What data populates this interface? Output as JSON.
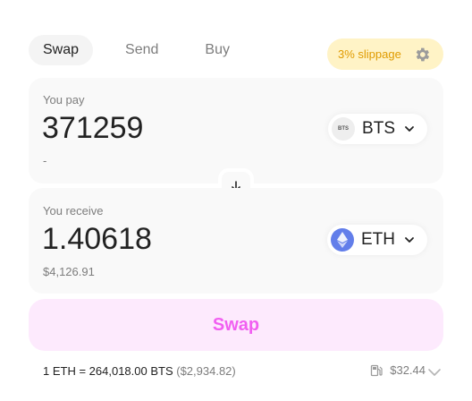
{
  "tabs": [
    {
      "label": "Swap",
      "active": true
    },
    {
      "label": "Send",
      "active": false
    },
    {
      "label": "Buy",
      "active": false
    }
  ],
  "slippage": {
    "label": "3% slippage",
    "icon": "gear-icon"
  },
  "pay": {
    "label": "You pay",
    "amount": "371259",
    "fiat": "-",
    "token": {
      "symbol": "BTS",
      "logo_text": "BTS"
    }
  },
  "receive": {
    "label": "You receive",
    "amount": "1.40618",
    "fiat": "$4,126.91",
    "token": {
      "symbol": "ETH",
      "logo": "ethereum-logo"
    }
  },
  "switch": {
    "icon": "arrow-down-icon"
  },
  "swap_button": {
    "label": "Swap"
  },
  "rate": {
    "text": "1 ETH = 264,018.00 BTS",
    "fiat": "($2,934.82)"
  },
  "gas": {
    "icon": "gas-pump-icon",
    "value": "$32.44"
  },
  "colors": {
    "accent": "#f15ff1",
    "swap_bg": "#fdeafd",
    "slippage_bg": "#fff3c6",
    "slippage_text": "#e09b00",
    "eth": "#627eea"
  }
}
